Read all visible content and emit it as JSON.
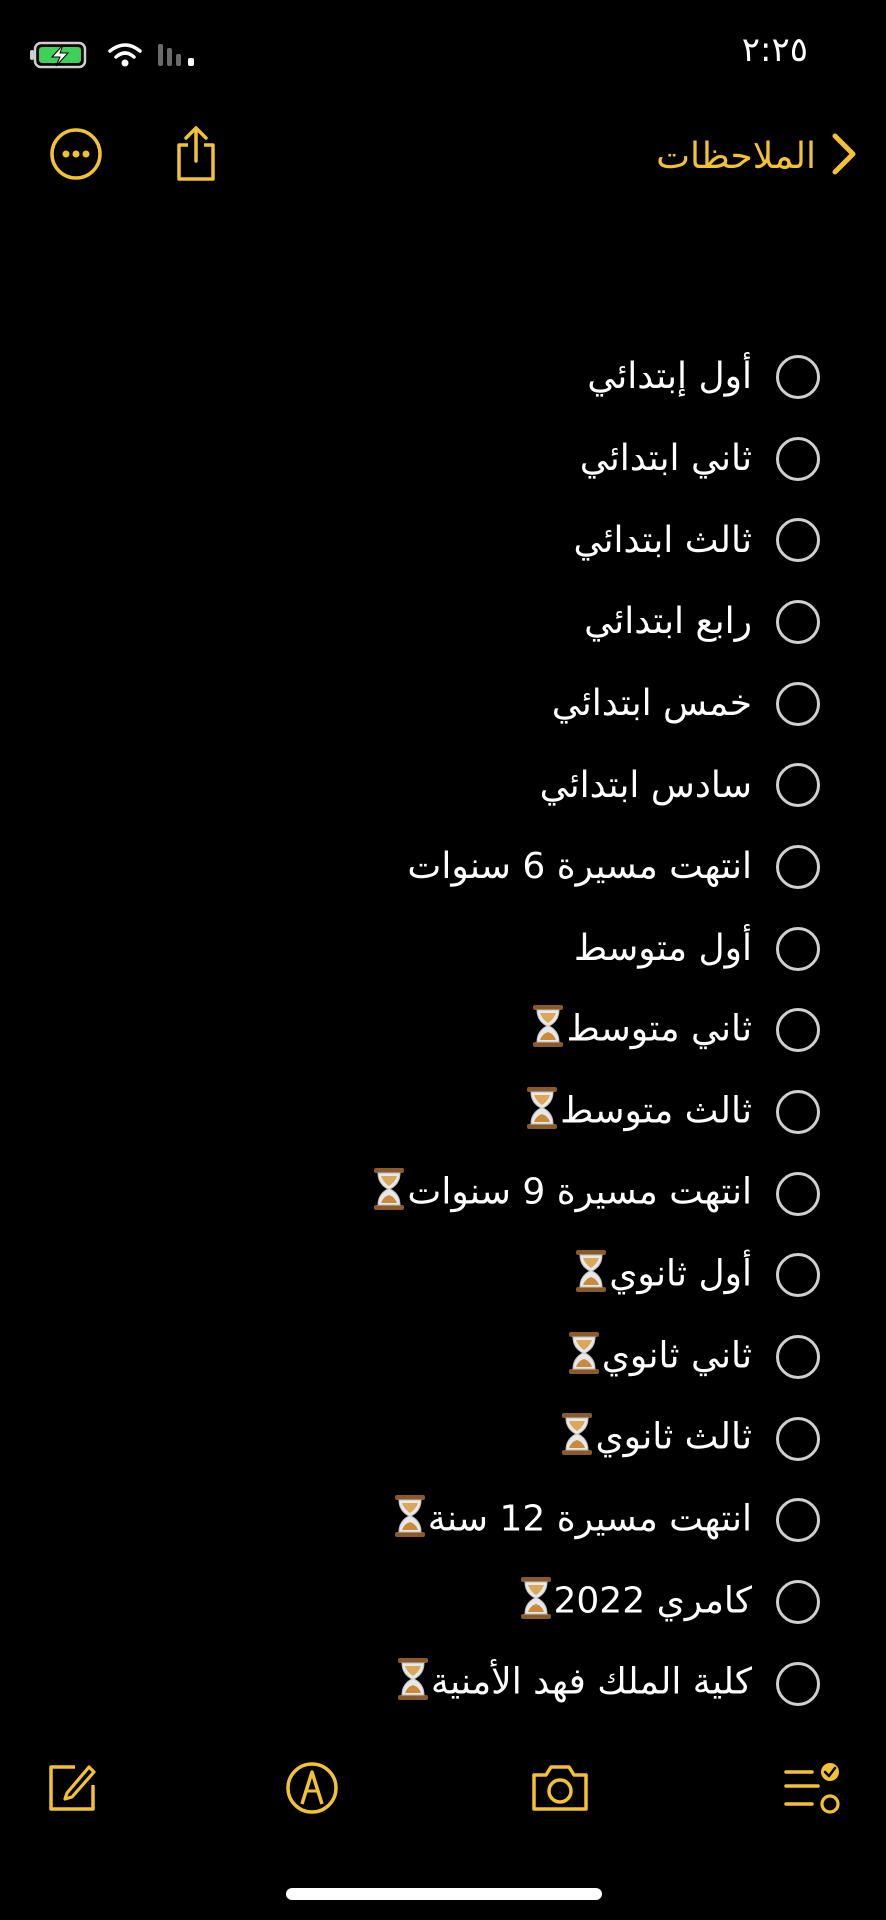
{
  "status_bar": {
    "time": "٢:٢٥",
    "icons": [
      "battery-charging-icon",
      "wifi-icon",
      "cellular-signal-icon"
    ]
  },
  "nav": {
    "back_label": "الملاحظات",
    "back_icon": "chevron-right-icon",
    "more_icon": "ellipsis-circle-icon",
    "share_icon": "share-icon"
  },
  "checklist": [
    {
      "text": "أول إبتدائي",
      "hourglass": false,
      "checked": false
    },
    {
      "text": "ثاني ابتدائي",
      "hourglass": false,
      "checked": false
    },
    {
      "text": "ثالث ابتدائي",
      "hourglass": false,
      "checked": false
    },
    {
      "text": "رابع ابتدائي",
      "hourglass": false,
      "checked": false
    },
    {
      "text": "خمس ابتدائي",
      "hourglass": false,
      "checked": false
    },
    {
      "text": "سادس ابتدائي",
      "hourglass": false,
      "checked": false
    },
    {
      "text": "انتهت مسيرة 6 سنوات",
      "hourglass": false,
      "checked": false
    },
    {
      "text": "أول متوسط",
      "hourglass": false,
      "checked": false
    },
    {
      "text": "ثاني متوسط",
      "hourglass": true,
      "checked": false
    },
    {
      "text": "ثالث متوسط",
      "hourglass": true,
      "checked": false
    },
    {
      "text": "انتهت مسيرة 9 سنوات",
      "hourglass": true,
      "checked": false
    },
    {
      "text": "أول ثانوي",
      "hourglass": true,
      "checked": false
    },
    {
      "text": "ثاني ثانوي",
      "hourglass": true,
      "checked": false
    },
    {
      "text": "ثالث ثانوي",
      "hourglass": true,
      "checked": false
    },
    {
      "text": "انتهت مسيرة 12 سنة",
      "hourglass": true,
      "checked": false
    },
    {
      "text": "كامري 2022",
      "hourglass": true,
      "checked": false
    },
    {
      "text": "كلية الملك فهد الأمنية",
      "hourglass": true,
      "checked": false
    }
  ],
  "toolbar": {
    "icons": [
      "compose-icon",
      "markup-icon",
      "camera-icon",
      "checklist-icon"
    ]
  },
  "colors": {
    "accent": "#f2c230",
    "background": "#000000",
    "text": "#ffffff",
    "circle": "#cfcfcf"
  }
}
